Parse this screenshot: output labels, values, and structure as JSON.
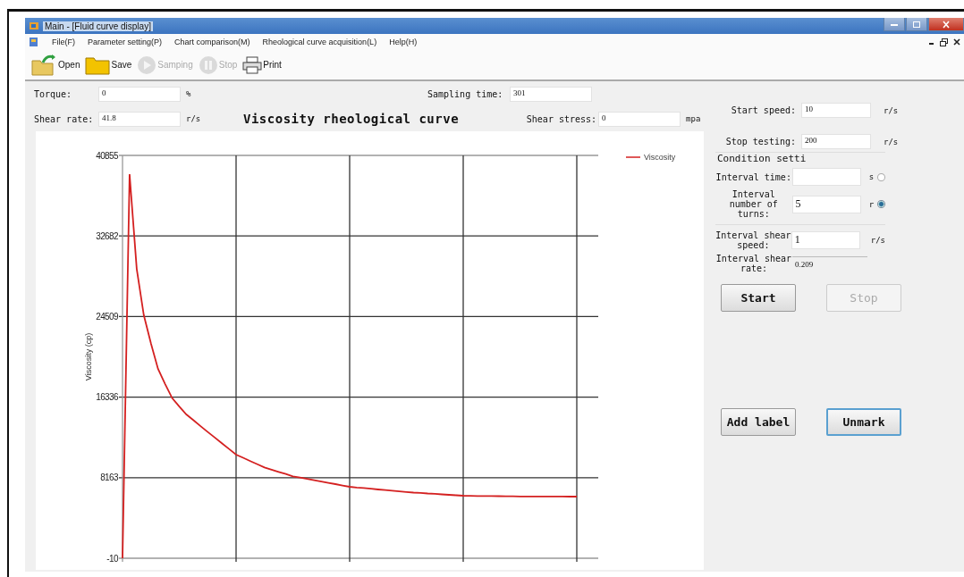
{
  "window": {
    "title": "Main - [Fluid curve display]"
  },
  "menu": [
    "File(F)",
    "Parameter setting(P)",
    "Chart comparison(M)",
    "Rheological curve acquisition(L)",
    "Help(H)"
  ],
  "toolbar": [
    {
      "label": "Open",
      "kind": "open",
      "disabled": false
    },
    {
      "label": "Save",
      "kind": "save",
      "disabled": false
    },
    {
      "label": "Samping",
      "kind": "sampling",
      "disabled": true
    },
    {
      "label": "Stop",
      "kind": "stop",
      "disabled": true
    },
    {
      "label": "Print",
      "kind": "print",
      "disabled": false
    }
  ],
  "readings": {
    "torque": {
      "label": "Torque:",
      "value": "0",
      "unit": "%"
    },
    "shear_rate": {
      "label": "Shear rate:",
      "value": "41.8",
      "unit": "r/s"
    },
    "sampling_time": {
      "label": "Sampling time:",
      "value": "301"
    },
    "shear_stress": {
      "label": "Shear stress:",
      "value": "0",
      "unit": "mpa"
    }
  },
  "chart": {
    "chart_data": {
      "type": "line",
      "title": "Viscosity rheological curve",
      "ylabel": "Viscosity (cp)",
      "ylim": [
        -10,
        40855
      ],
      "yticks": [
        -10,
        8163,
        16336,
        24509,
        32682,
        40855
      ],
      "grid": true,
      "categories": [
        null,
        null,
        null,
        null,
        null,
        null,
        null,
        null,
        null,
        null,
        null,
        null,
        null,
        null,
        null,
        null,
        null,
        null,
        null,
        null,
        null,
        null,
        null,
        null,
        null,
        null,
        null,
        null,
        null,
        null,
        null,
        null,
        null,
        null,
        null,
        null,
        null,
        null,
        null,
        null,
        null,
        null,
        null,
        null,
        null,
        null,
        null,
        null,
        null,
        null,
        null,
        null,
        null,
        null,
        null,
        null,
        null,
        null,
        null,
        null,
        null,
        null,
        null,
        null,
        null
      ],
      "series": [
        {
          "name": "Viscosity",
          "color": "#d42020",
          "values": [
            -10,
            38950,
            29340,
            24650,
            21780,
            19200,
            17680,
            16230,
            15380,
            14580,
            13990,
            13390,
            12800,
            12230,
            11650,
            11080,
            10500,
            10180,
            9850,
            9530,
            9200,
            8980,
            8750,
            8530,
            8300,
            8170,
            8040,
            7900,
            7770,
            7640,
            7510,
            7370,
            7240,
            7170,
            7110,
            7040,
            6970,
            6900,
            6840,
            6770,
            6700,
            6650,
            6610,
            6560,
            6520,
            6470,
            6420,
            6380,
            6330,
            6320,
            6310,
            6300,
            6300,
            6290,
            6280,
            6270,
            6260,
            6260,
            6260,
            6250,
            6250,
            6250,
            6250,
            6240,
            6240
          ]
        }
      ]
    }
  },
  "settings": {
    "start_speed": {
      "label": "Start speed:",
      "value": "10",
      "unit": "r/s"
    },
    "stop_testing": {
      "label": "Stop testing:",
      "value": "200",
      "unit": "r/s"
    },
    "condition": {
      "title": "Condition setti",
      "modes": [
        {
          "label": "Interval time:",
          "unit": "s",
          "selected": false
        },
        {
          "label": "Interval number of turns:",
          "value": "5",
          "unit": "r",
          "selected": true
        }
      ],
      "shear_speed": {
        "label": "Interval shear speed:",
        "value": "1",
        "unit": "r/s"
      },
      "shear_rate": {
        "label": "Interval shear rate:",
        "value": "0.209"
      }
    },
    "run_buttons": [
      {
        "label": "Start",
        "disabled": false
      },
      {
        "label": "Stop",
        "disabled": true
      }
    ],
    "mark_buttons": [
      {
        "label": "Add label",
        "focused": false
      },
      {
        "label": "Unmark",
        "focused": true
      }
    ]
  }
}
